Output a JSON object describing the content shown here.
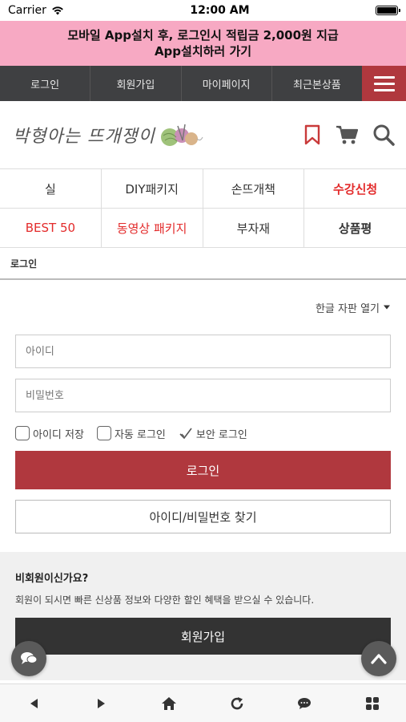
{
  "status_bar": {
    "carrier": "Carrier",
    "time": "12:00 AM"
  },
  "promo": {
    "line1": "모바일 App설치 후, 로그인시 적립금 2,000원 지급",
    "line2": "App설치하러 가기"
  },
  "topnav": {
    "items": [
      "로그인",
      "회원가입",
      "마이페이지",
      "최근본상품"
    ],
    "menu_icon": "hamburger-icon"
  },
  "header": {
    "logo_text": "박형아는 뜨개쟁이",
    "icons": [
      "bookmark-icon",
      "cart-icon",
      "search-icon"
    ]
  },
  "categories": [
    {
      "label": "실"
    },
    {
      "label": "DIY패키지"
    },
    {
      "label": "손뜨개책"
    },
    {
      "label": "수강신청"
    },
    {
      "label": "BEST 50"
    },
    {
      "label": "동영상 패키지"
    },
    {
      "label": "부자재"
    },
    {
      "label": "상품평"
    }
  ],
  "breadcrumb": "로그인",
  "login": {
    "keyboard_toggle": "한글 자판 열기",
    "id_placeholder": "아이디",
    "pw_placeholder": "비밀번호",
    "save_id": "아이디 저장",
    "auto_login": "자동 로그인",
    "secure_login": "보안 로그인",
    "login_button": "로그인",
    "find_button": "아이디/비밀번호 찾기"
  },
  "guest": {
    "title": "비회원이신가요?",
    "desc": "회원이 되시면 빠른 신상품 정보와 다양한 할인 혜택을 받으실 수 있습니다.",
    "join_button": "회원가입"
  },
  "colors": {
    "accent": "#b0383e",
    "promo_bg": "#f7a9c3",
    "nav_bg": "#3f4042",
    "highlight": "#e32b2b"
  }
}
